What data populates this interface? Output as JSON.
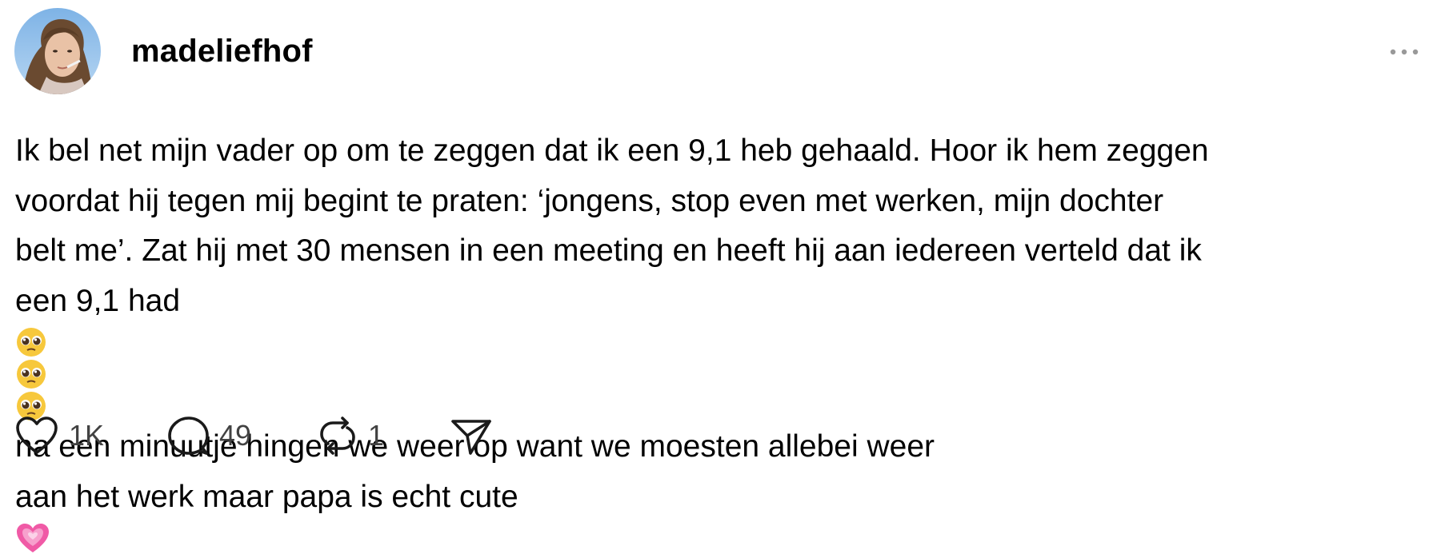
{
  "post": {
    "username": "madeliefhof",
    "text_lines": [
      "Ik bel net mijn vader op om te zeggen dat ik een 9,1 heb gehaald. Hoor ik hem zeggen",
      "voordat hij tegen mij begint te praten: ‘jongens, stop even met werken, mijn dochter",
      "belt me’. Zat hij met 30 mensen in een meeting en heeft hij aan iedereen verteld dat ik",
      "een 9,1 had",
      "na een minuutje hingen we weer op want we moesten allebei weer",
      "aan het werk maar papa is echt cute"
    ],
    "emoji": {
      "pleading_face": "pleading-face-emoji",
      "heart": "growing-heart-emoji"
    },
    "actions": {
      "likes": "1K",
      "comments": "49",
      "reposts": "1"
    }
  },
  "icons": {
    "like": "heart-icon",
    "comment": "speech-bubble-icon",
    "repost": "repost-icon",
    "share": "paper-plane-icon",
    "more": "ellipsis-icon"
  },
  "colors": {
    "text": "#000000",
    "counts": "#424242",
    "icons": "#1a1a1a",
    "more_dots": "#999999",
    "emoji_heart": "#f05aa6"
  }
}
